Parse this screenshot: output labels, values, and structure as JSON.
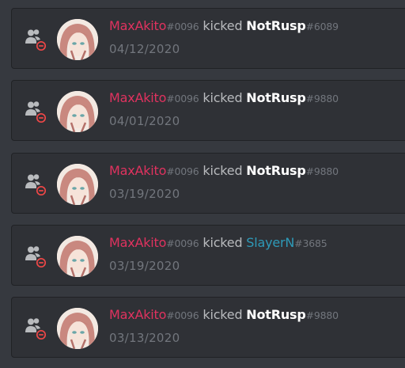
{
  "audit_log": {
    "entries": [
      {
        "actor": "MaxAkito",
        "actor_discriminator": "#0096",
        "action": "kicked",
        "target": "NotRusp",
        "target_discriminator": "#6089",
        "target_color": "#ffffff",
        "date": "04/12/2020",
        "icon": "member-remove-icon"
      },
      {
        "actor": "MaxAkito",
        "actor_discriminator": "#0096",
        "action": "kicked",
        "target": "NotRusp",
        "target_discriminator": "#9880",
        "target_color": "#ffffff",
        "date": "04/01/2020",
        "icon": "member-remove-icon"
      },
      {
        "actor": "MaxAkito",
        "actor_discriminator": "#0096",
        "action": "kicked",
        "target": "NotRusp",
        "target_discriminator": "#9880",
        "target_color": "#ffffff",
        "date": "03/19/2020",
        "icon": "member-remove-icon"
      },
      {
        "actor": "MaxAkito",
        "actor_discriminator": "#0096",
        "action": "kicked",
        "target": "SlayerN",
        "target_discriminator": "#3685",
        "target_color": "#2e9ab8",
        "date": "03/19/2020",
        "icon": "member-remove-icon"
      },
      {
        "actor": "MaxAkito",
        "actor_discriminator": "#0096",
        "action": "kicked",
        "target": "NotRusp",
        "target_discriminator": "#9880",
        "target_color": "#ffffff",
        "date": "03/13/2020",
        "icon": "member-remove-icon"
      }
    ]
  },
  "colors": {
    "background": "#36393f",
    "entry_background": "#2f3136",
    "actor": "#e0325f",
    "discriminator": "#72767d",
    "remove_badge": "#f04747"
  }
}
